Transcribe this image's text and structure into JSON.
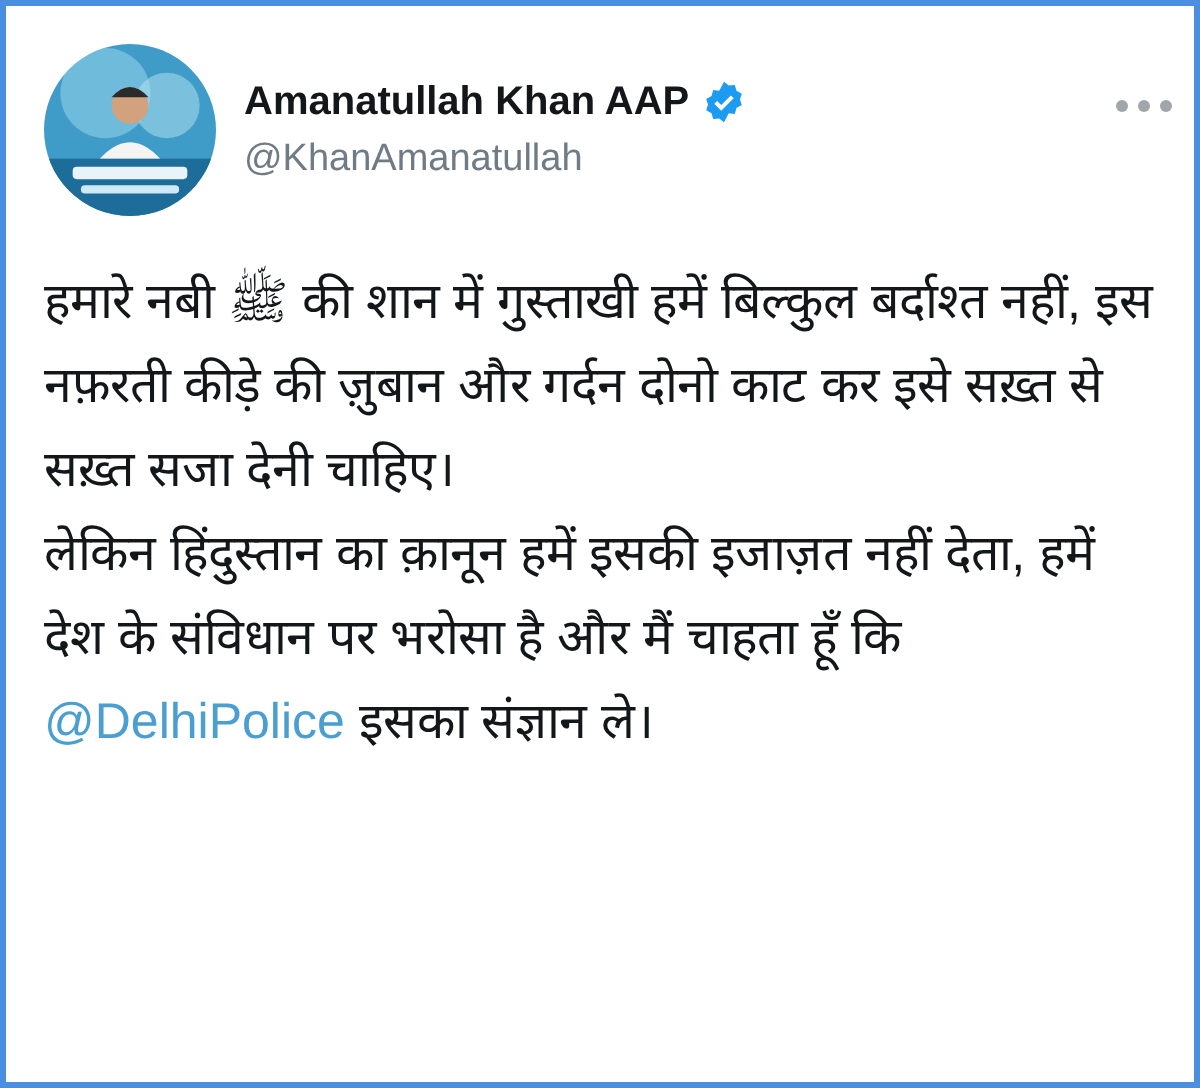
{
  "author": {
    "name": "Amanatullah Khan AAP",
    "verified": true,
    "handle": "@KhanAmanatullah"
  },
  "tweet": {
    "paragraphs": [
      {
        "before": "हमारे नबी ﷺ की शान में गुस्ताखी हमें बिल्कुल बर्दाश्त नहीं, इस नफ़रती कीड़े की ज़ुबान और गर्दन दोनो काट कर इसे सख़्त से सख़्त सजा देनी चाहिए।"
      },
      {
        "before": "लेकिन हिंदुस्तान का क़ानून हमें इसकी इजाज़त नहीं देता, हमें देश के संविधान पर भरोसा है और मैं चाहता हूँ कि ",
        "mention": "@DelhiPolice",
        "after": " इसका संज्ञान ले।"
      }
    ]
  }
}
